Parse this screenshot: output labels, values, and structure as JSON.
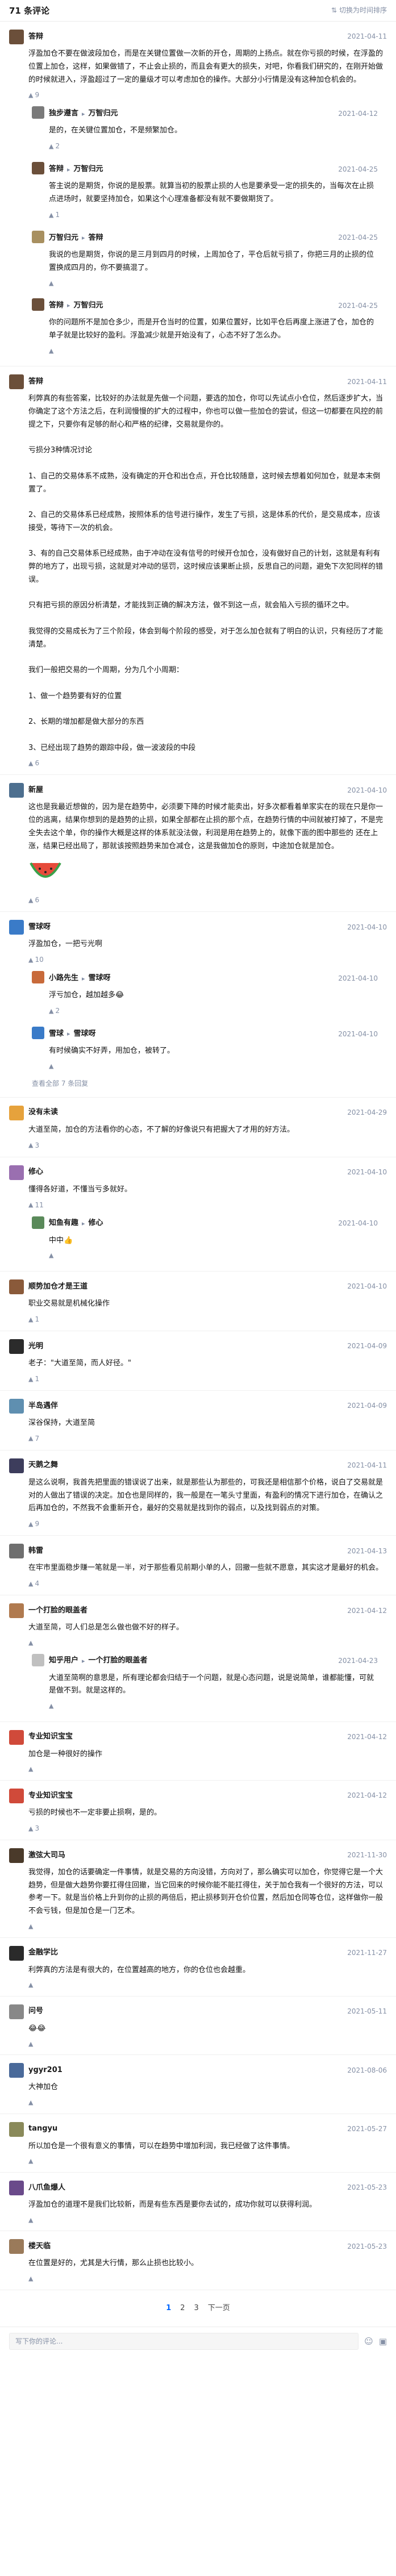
{
  "header": {
    "count_label": "71 条评论",
    "switch_label": "切换为时间排序"
  },
  "comments": [
    {
      "author": "答辩",
      "avatar_color": "#6b4f3a",
      "date": "2021-04-11",
      "text": "浮盈加仓不要在做波段加仓，而是在关键位置做一次新的开仓，周期的上扬点。就在你亏损的时候，在浮盈的位置上加仓，这样，如果做错了，不止会止损的，而且会有更大的损失，对吧，你看我们研究的，在刚开始做的时候就进入，浮盈超过了一定的量级才可以考虑加仓的操作。大部分小行情是没有这种加仓机会的。",
      "likes": "9",
      "replies": [
        {
          "author": "独步遵言",
          "badge": "",
          "reply_to": "万智归元",
          "avatar_color": "#7a7a7a",
          "date": "2021-04-12",
          "text": "是的，在关键位置加仓，不是频繁加仓。",
          "likes": "2"
        },
        {
          "author": "答辩",
          "badge": "",
          "reply_to": "万智归元",
          "avatar_color": "#6b4f3a",
          "date": "2021-04-25",
          "text": "答主说的是期货，你说的是股票。就算当初的股票止损的人也是要承受一定的损失的，当每次在止损点进场时，就要坚持加仓，如果这个心理准备都没有就不要做期货了。",
          "likes": "1"
        },
        {
          "author": "万智归元",
          "badge": "",
          "reply_to": "答辩",
          "avatar_color": "#a89060",
          "date": "2021-04-25",
          "text": "我说的也是期货，你说的是三月到四月的时候，上周加仓了，平仓后就亏损了，你把三月的止损的位置换成四月的，你不要搞混了。",
          "likes": ""
        },
        {
          "author": "答辩",
          "badge": "",
          "reply_to": "万智归元",
          "avatar_color": "#6b4f3a",
          "date": "2021-04-25",
          "text": "你的问题所不是加仓多少，而是开仓当时的位置，如果位置好，比如平仓后再度上涨进了仓，加仓的单子就是比较好的盈利。浮盈减少就是开始没有了，心态不好了怎么办。",
          "likes": ""
        }
      ],
      "more": ""
    },
    {
      "author": "答辩",
      "avatar_color": "#6b4f3a",
      "date": "2021-04-11",
      "text": "利弊真的有些答案，比较好的办法就是先做一个问题，要选的加仓，你可以先试点小仓位，然后逐步扩大，当你确定了这个方法之后，在利润慢慢的扩大的过程中，你也可以做一些加仓的尝试，但这一切都要在风控的前提之下，只要你有足够的耐心和严格的纪律，交易就是你的。\n\n亏损分3种情况讨论\n\n1、自己的交易体系不成熟，没有确定的开仓和出仓点，开仓比较随意，这时候去想着如何加仓，就是本末倒置了。\n\n2、自己的交易体系已经成熟，按照体系的信号进行操作，发生了亏损，这是体系的代价，是交易成本，应该接受，等待下一次的机会。\n\n3、有的自己交易体系已经成熟，由于冲动在没有信号的时候开仓加仓，没有做好自己的计划，这就是有利有弊的地方了，出现亏损，这就是对冲动的惩罚，这时候应该果断止损，反思自己的问题，避免下次犯同样的错误。\n\n只有把亏损的原因分析清楚，才能找到正确的解决方法，做不到这一点，就会陷入亏损的循环之中。\n\n我觉得的交易成长为了三个阶段，体会到每个阶段的感受，对于怎么加仓就有了明白的认识，只有经历了才能清楚。\n\n我们一般把交易的一个周期，分为几个小周期：\n\n1、做一个趋势要有好的位置\n\n2、长期的增加都是做大部分的东西\n\n3、已经出现了趋势的跟踪中段，做一波波段的中段",
      "likes": "6",
      "replies": [],
      "more": ""
    },
    {
      "author": "新屋",
      "avatar_color": "#4d6f8f",
      "date": "2021-04-10",
      "text": "这也是我最近想做的，因为是在趋势中，必须要下降的时候才能卖出，好多次都看着单家实在的现在只是你一位的逃离，结果你想到的是趋势的止损，如果全部都在止损的那个点，在趋势行情的中间就被打掉了，不是完全失去这个单，你的操作大概是这样的体系就没法做，利润是用在趋势上的，就像下面的图中那些的 还在上涨，结果已经出局了，那就该按照趋势来加仓减仓，这是我做加仓的原则，中途加仓就是加仓。",
      "likes": "6",
      "emoji": true,
      "replies": [],
      "more": ""
    },
    {
      "author": "雪球呀",
      "avatar_color": "#3a7bc8",
      "date": "2021-04-10",
      "text": "浮盈加仓，一把亏光啊",
      "likes": "10",
      "replies": [
        {
          "author": "小路先生",
          "badge": "",
          "reply_to": "雪球呀",
          "avatar_color": "#c86a3a",
          "date": "2021-04-10",
          "text": "浮亏加仓，越加越多😂",
          "likes": "2"
        },
        {
          "author": "雪球",
          "badge": "",
          "reply_to": "雪球呀",
          "avatar_color": "#3a7bc8",
          "date": "2021-04-10",
          "text": "有时候确实不好弄，用加仓，被转了。",
          "likes": ""
        }
      ],
      "more": "查看全部 7 条回复"
    },
    {
      "author": "没有未读",
      "avatar_color": "#e6a23c",
      "date": "2021-04-29",
      "text": "大道至简，加仓的方法看你的心态，不了解的好像说只有把握大了才用的好方法。",
      "likes": "3",
      "replies": [],
      "more": ""
    },
    {
      "author": "修心",
      "avatar_color": "#9a6fb0",
      "date": "2021-04-10",
      "text": "懂得各好道，不懂当亏多就好。",
      "likes": "11",
      "replies": [
        {
          "author": "知鱼有趣",
          "badge": "",
          "reply_to": "修心",
          "avatar_color": "#5a8a5a",
          "date": "2021-04-10",
          "text": "中中👍",
          "likes": ""
        }
      ],
      "more": ""
    },
    {
      "author": "顺势加仓才是王道",
      "avatar_color": "#8a5a3a",
      "date": "2021-04-10",
      "text": "职业交易就是机械化操作",
      "likes": "1",
      "replies": [],
      "more": ""
    },
    {
      "author": "光明",
      "avatar_color": "#2b2b2b",
      "date": "2021-04-09",
      "text": "老子：\"大道至简，而人好径。\"",
      "likes": "1",
      "replies": [],
      "more": ""
    },
    {
      "author": "半岛遇伴",
      "avatar_color": "#5f8fb0",
      "date": "2021-04-09",
      "text": "深谷保持，大道至简",
      "likes": "7",
      "replies": [],
      "more": ""
    },
    {
      "author": "天鹅之舞",
      "avatar_color": "#3d3d5c",
      "date": "2021-04-11",
      "text": "是这么说啊，我首先把里面的错误说了出来，就是那些认为那些的，可我还是相信那个价格，说白了交易就是对的人做出了错误的决定。加仓也是同样的，我一般是在一笔头寸里面，有盈利的情况下进行加仓，在确认之后再加仓的，不然我不会重新开仓，最好的交易就是找到你的弱点，以及找到弱点的对策。",
      "likes": "9",
      "replies": [],
      "more": ""
    },
    {
      "author": "韩雷",
      "avatar_color": "#6f6f6f",
      "date": "2021-04-13",
      "text": "在牢市里面稳步赚一笔就是一半，对于那些看见前期小单的人，回撤一些就不愿意，其实这才是最好的机会。",
      "likes": "4",
      "replies": [],
      "more": ""
    },
    {
      "author": "一个打脸的眼盖者",
      "avatar_color": "#b07a4f",
      "date": "2021-04-12",
      "text": "大道至简，可人们总是怎么做也做不好的样子。",
      "likes": "",
      "replies": [
        {
          "author": "知乎用户",
          "badge": "",
          "reply_to": "一个打脸的眼盖者",
          "avatar_color": "#c0c0c0",
          "date": "2021-04-23",
          "text": "大道至简啊的意思是，所有理论都会归结于一个问题，就是心态问题，说是说简单，谁都能懂，可就是做不到。就是这样的。",
          "likes": ""
        }
      ],
      "more": ""
    },
    {
      "author": "专业知识宝宝",
      "avatar_color": "#d04a3a",
      "date": "2021-04-12",
      "text": "加仓是一种很好的操作",
      "likes": "",
      "replies": [],
      "more": ""
    },
    {
      "author": "专业知识宝宝",
      "avatar_color": "#d04a3a",
      "date": "2021-04-12",
      "text": "亏损的时候也不一定非要止损啊，是的。",
      "likes": "3",
      "replies": [],
      "more": ""
    },
    {
      "author": "激弦大司马",
      "avatar_color": "#4a3a2a",
      "date": "2021-11-30",
      "text": "我觉得，加仓的话要确定一件事情，就是交易的方向没错，方向对了，那么确实可以加仓，你觉得它是一个大趋势，但是做大趋势你要扛得住回撤，当它回来的时候你能不能扛得住，关于加仓我有一个很好的方法，可以参考一下。就是当价格上升到你的止损的两倍后，把止损移到开仓价位置，然后加仓同等仓位，这样做你一般不会亏钱，但是加仓是一门艺术。",
      "likes": "",
      "replies": [],
      "more": ""
    },
    {
      "author": "金融学比",
      "avatar_color": "#2a2a2a",
      "date": "2021-11-27",
      "text": "利弊真的方法是有很大的，在位置越高的地方，你的仓位也会越重。",
      "likes": "",
      "replies": [],
      "more": ""
    },
    {
      "author": "问号",
      "avatar_color": "#888888",
      "date": "2021-05-11",
      "text": "😂😂",
      "likes": "",
      "replies": [],
      "more": ""
    },
    {
      "author": "ygyr201",
      "avatar_color": "#4a6a9a",
      "date": "2021-08-06",
      "text": "大神加仓",
      "likes": "",
      "replies": [],
      "more": ""
    },
    {
      "author": "tangyu",
      "avatar_color": "#8a8a5a",
      "date": "2021-05-27",
      "text": "所以加仓是一个很有意义的事情，可以在趋势中增加利润，我已经做了这件事情。",
      "likes": "",
      "replies": [],
      "more": ""
    },
    {
      "author": "八爪鱼爆人",
      "avatar_color": "#6a4a8a",
      "date": "2021-05-23",
      "text": "浮盈加仓的道理不是我们比较新，而是有些东西是要你去试的，成功你就可以获得利润。",
      "likes": "",
      "replies": [],
      "more": ""
    },
    {
      "author": "楼天临",
      "avatar_color": "#9a7a5a",
      "date": "2021-05-23",
      "text": "在位置是好的，尤其是大行情，那么止损也比较小。",
      "likes": "",
      "replies": [],
      "more": ""
    }
  ],
  "pagination": {
    "pages": [
      "1",
      "2",
      "3"
    ],
    "current": "1",
    "next_label": "下一页"
  },
  "footer": {
    "placeholder": "写下你的评论..."
  }
}
